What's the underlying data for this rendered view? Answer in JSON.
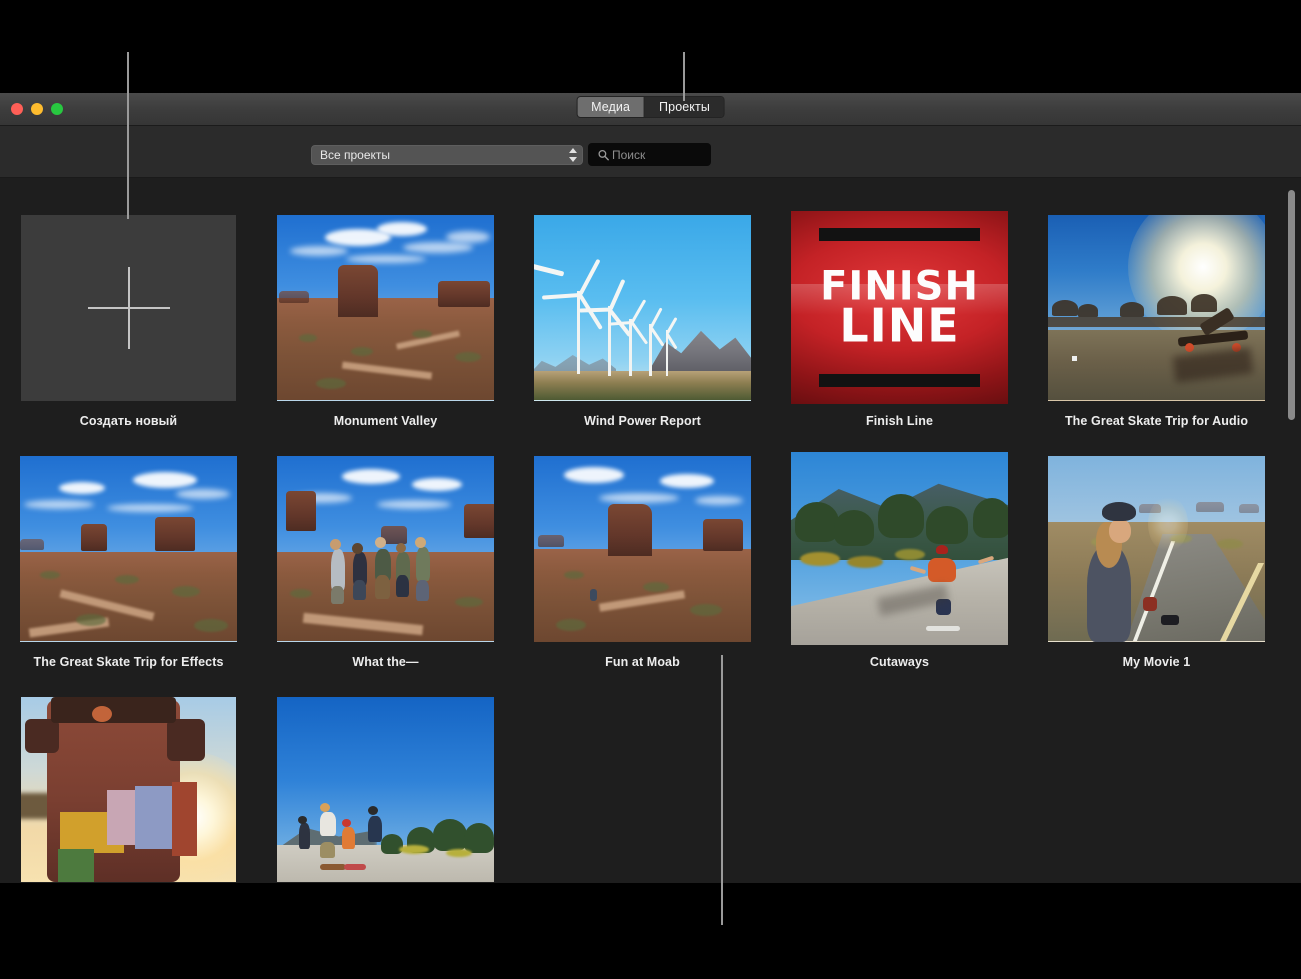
{
  "window": {
    "traffic_lights": [
      {
        "name": "close",
        "color": "#ff5f57"
      },
      {
        "name": "minimize",
        "color": "#febc2e"
      },
      {
        "name": "zoom",
        "color": "#28c840"
      }
    ],
    "tabs": [
      {
        "label": "Медиа",
        "selected": true
      },
      {
        "label": "Проекты",
        "selected": false
      }
    ]
  },
  "filter_bar": {
    "project_filter_value": "Все проекты",
    "search_placeholder": "Поиск",
    "search_value": "",
    "search_icon": "search-icon"
  },
  "grid": {
    "items": [
      {
        "label": "Создать новый",
        "kind": "new-project",
        "thumb": "plus-icon"
      },
      {
        "label": "Monument Valley",
        "kind": "project",
        "thumb": "desert-mesa-photo"
      },
      {
        "label": "Wind Power Report",
        "kind": "project",
        "thumb": "wind-turbines-photo"
      },
      {
        "label": "Finish Line",
        "kind": "project",
        "thumb": "finish-line-title-card"
      },
      {
        "label": "The Great Skate Trip for Audio",
        "kind": "project",
        "thumb": "sunset-skateboard-photo"
      },
      {
        "label": "The Great Skate Trip for Effects",
        "kind": "project",
        "thumb": "monument-valley-vista-photo"
      },
      {
        "label": "What the—",
        "kind": "project",
        "thumb": "group-jumping-photo"
      },
      {
        "label": "Fun at Moab",
        "kind": "project",
        "thumb": "moab-mesa-photo"
      },
      {
        "label": "Cutaways",
        "kind": "project",
        "thumb": "skater-downhill-photo"
      },
      {
        "label": "My Movie 1",
        "kind": "project",
        "thumb": "girl-on-road-photo"
      },
      {
        "label": "",
        "kind": "project",
        "thumb": "skateboard-deck-macro-photo"
      },
      {
        "label": "",
        "kind": "project",
        "thumb": "walking-skaters-photo"
      }
    ]
  },
  "scrollbar": {
    "name": "vertical-scrollbar"
  },
  "colors": {
    "window_background": "#1e1e1e",
    "titlebar": "#3c3c3c",
    "filter_bar": "#2b2b2b",
    "tab_selected": "#6e6e6e",
    "label_text": "#ededed",
    "callout_line": "#9a9a9a"
  }
}
